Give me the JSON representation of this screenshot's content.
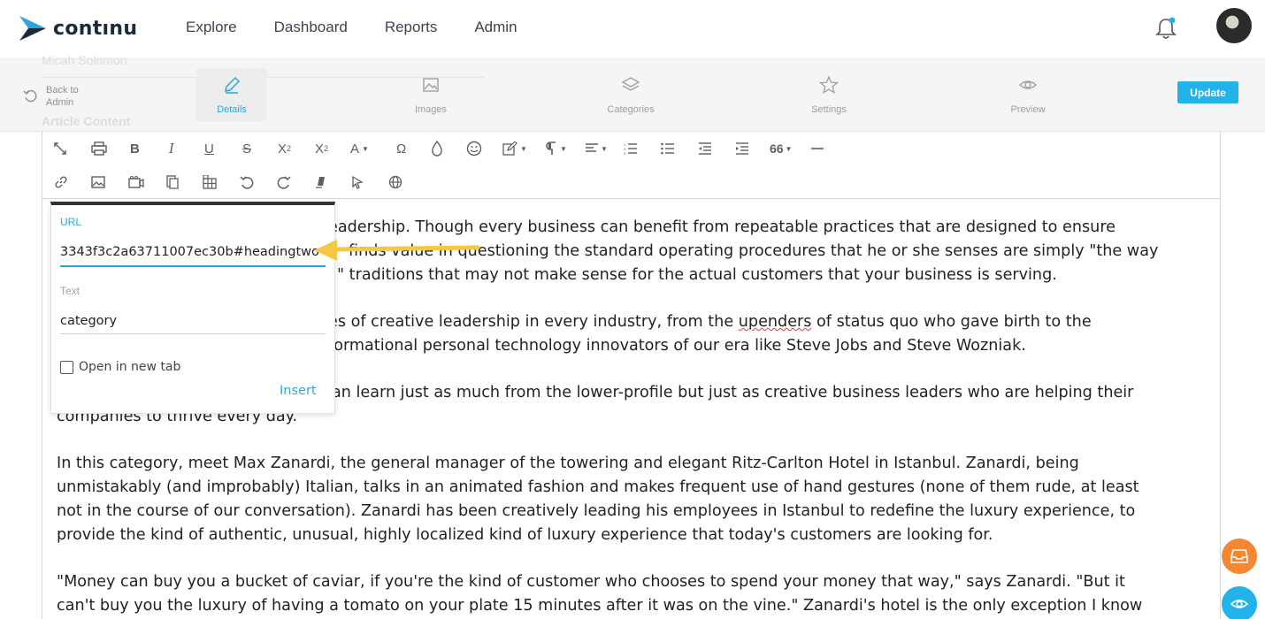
{
  "brand": {
    "name": "contınu"
  },
  "nav": {
    "items": [
      {
        "label": "Explore"
      },
      {
        "label": "Dashboard"
      },
      {
        "label": "Reports"
      },
      {
        "label": "Admin"
      }
    ]
  },
  "subbar": {
    "ghost_author": "Micah Solomon",
    "ghost_section": "Article Content",
    "back_line1": "Back to",
    "back_line2": "Admin",
    "tabs": [
      {
        "label": "Details",
        "icon": "pencil-icon",
        "active": true
      },
      {
        "label": "Images",
        "icon": "image-icon",
        "active": false
      },
      {
        "label": "Categories",
        "icon": "layers-icon",
        "active": false
      },
      {
        "label": "Settings",
        "icon": "star-icon",
        "active": false
      },
      {
        "label": "Preview",
        "icon": "eye-icon",
        "active": false
      }
    ],
    "update_label": "Update"
  },
  "toolbar": {
    "row1": [
      "expand-icon",
      "print-icon",
      "bold-icon",
      "italic-icon",
      "underline-icon",
      "strikethrough-icon",
      "subscript-icon",
      "superscript-icon",
      "font-color-icon",
      "special-char-icon",
      "color-drop-icon",
      "emoji-icon",
      "edit-dropdown-icon",
      "paragraph-format-icon",
      "align-icon",
      "ordered-list-icon",
      "unordered-list-icon",
      "outdent-icon",
      "indent-icon",
      "quote-icon",
      "horizontal-rule-icon"
    ],
    "row2": [
      "link-icon",
      "insert-image-icon",
      "insert-video-icon",
      "insert-file-icon",
      "insert-table-icon",
      "undo-icon",
      "redo-icon",
      "clear-format-icon",
      "select-all-icon",
      "html-icon"
    ]
  },
  "content": {
    "paragraphs": [
      [
        "eadership. Though every business can benefit from repeatable practices that are designed to ensure",
        "finds value in questioning the standard operating procedures that he or she senses are simply \"the way",
        "\" traditions that may not make sense for the actual customers that your business is serving."
      ],
      [
        "es of creative leadership in every industry, from the ",
        "upenders",
        " of status quo who gave birth to the",
        "formational personal technology innovators of our era like Steve Jobs and Steve Wozniak."
      ],
      [
        "an learn just as much from the lower-profile but just as creative business leaders who are helping their",
        "companies to thrive every day."
      ],
      [
        "In this category, meet Max Zanardi, the general manager of the towering and elegant Ritz-Carlton Hotel in Istanbul. Zanardi, being",
        "unmistakably (and improbably) Italian, talks in an animated fashion and makes frequent use of hand gestures (none of them rude, at least",
        "not in the course of our conversation). Zanardi has been creatively leading his employees in Istanbul to redefine the luxury experience, to",
        "provide the kind of authentic, unusual, highly localized kind of luxury experience that today's customers are looking for."
      ],
      [
        "\"Money can buy you a bucket of caviar, if you're the kind of customer who chooses to spend your money that way,\" says Zanardi. \"But it",
        "can't buy you the luxury of having a tomato on your plate 15 minutes after it was on the vine.\" Zanardi's hotel is the only exception I know"
      ]
    ]
  },
  "link_popup": {
    "url_label": "URL",
    "url_value": "3343f3c2a63711007ec30b#headingtwo",
    "text_label": "Text",
    "text_value": "category",
    "new_tab_label": "Open in new tab",
    "new_tab_checked": false,
    "insert_label": "Insert"
  },
  "colors": {
    "accent": "#22b3ea",
    "orange": "#f58632",
    "annotation_arrow": "#f5c842"
  }
}
